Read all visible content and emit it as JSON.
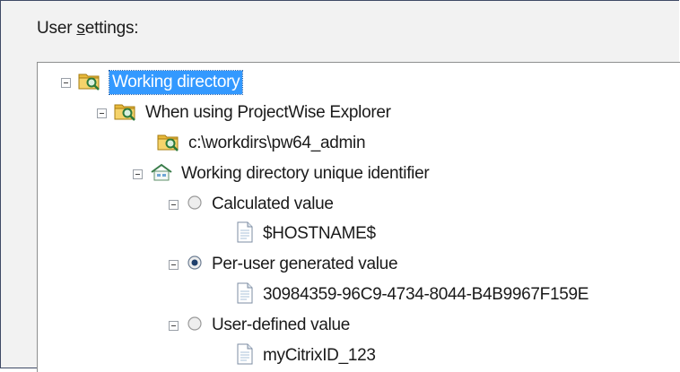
{
  "group_label": "User settings:",
  "group_label_parts": {
    "pre": "User ",
    "mnemonic": "s",
    "post": "ettings:"
  },
  "tree": {
    "working_directory": "Working directory",
    "when_using": "When using ProjectWise Explorer",
    "workdir_path": "c:\\workdirs\\pw64_admin",
    "unique_identifier": "Working directory unique identifier",
    "calculated_value": "Calculated value",
    "calculated_text": "$HOSTNAME$",
    "per_user_value": "Per-user generated value",
    "per_user_text": "30984359-96C9-4734-8044-B4B9967F159E",
    "user_defined_value": "User-defined value",
    "user_defined_text": "myCitrixID_123"
  },
  "selected_radio": "per_user_value",
  "colors": {
    "selection": "#3399ff",
    "folder": "#e8b93a",
    "panel_border": "#8e8f8f"
  },
  "icons": [
    "folder-search-icon",
    "house-icon",
    "radio-icon",
    "document-icon",
    "expander-minus-icon"
  ]
}
